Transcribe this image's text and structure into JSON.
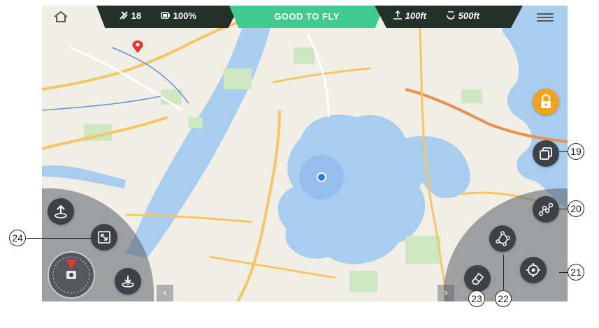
{
  "status_bar": {
    "satellites": "18",
    "battery": "100%",
    "status_text": "GOOD TO FLY",
    "altitude": "100ft",
    "distance": "500ft",
    "status_color": "#3fcb90"
  },
  "icons": [
    "home-icon",
    "satellite-icon",
    "battery-icon",
    "altitude-icon",
    "distance-icon",
    "menu-icon",
    "lock-icon",
    "layers-icon",
    "waypoint-route-icon",
    "polygon-route-icon",
    "locate-icon",
    "eraser-icon",
    "takeoff-icon",
    "fullscreen-icon",
    "return-home-icon",
    "compass-icon",
    "chevron-left-icon",
    "chevron-right-icon",
    "map-pin-icon"
  ],
  "callouts": {
    "c19": "19",
    "c20": "20",
    "c21": "21",
    "c22": "22",
    "c23": "23",
    "c24": "24"
  }
}
